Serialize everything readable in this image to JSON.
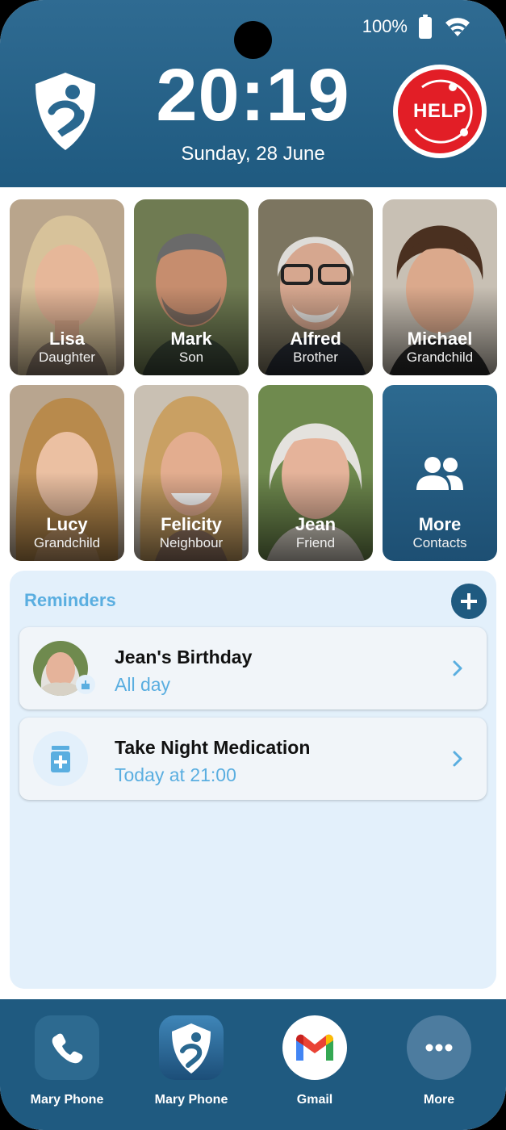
{
  "status": {
    "battery": "100%"
  },
  "header": {
    "time": "20:19",
    "date": "Sunday, 28 June",
    "help_label": "HELP"
  },
  "contacts": [
    {
      "name": "Lisa",
      "relation": "Daughter"
    },
    {
      "name": "Mark",
      "relation": "Son"
    },
    {
      "name": "Alfred",
      "relation": "Brother"
    },
    {
      "name": "Michael",
      "relation": "Grandchild"
    },
    {
      "name": "Lucy",
      "relation": "Grandchild"
    },
    {
      "name": "Felicity",
      "relation": "Neighbour"
    },
    {
      "name": "Jean",
      "relation": "Friend"
    },
    {
      "name": "More",
      "relation": "Contacts"
    }
  ],
  "reminders": {
    "title": "Reminders",
    "items": [
      {
        "title": "Jean's Birthday",
        "subtitle": "All day",
        "icon": "birthday-cake-icon"
      },
      {
        "title": "Take Night Medication",
        "subtitle": "Today at 21:00",
        "icon": "medication-icon"
      }
    ]
  },
  "dock": [
    {
      "label": "Mary Phone",
      "icon": "phone-icon"
    },
    {
      "label": "Mary Phone",
      "icon": "app-logo-icon"
    },
    {
      "label": "Gmail",
      "icon": "gmail-icon"
    },
    {
      "label": "More",
      "icon": "more-dots-icon"
    }
  ],
  "colors": {
    "header": "#2f6b92",
    "accent": "#5aaee0",
    "help": "#e21e26",
    "panel": "#e3f0fb",
    "dock": "#1f5a80"
  }
}
